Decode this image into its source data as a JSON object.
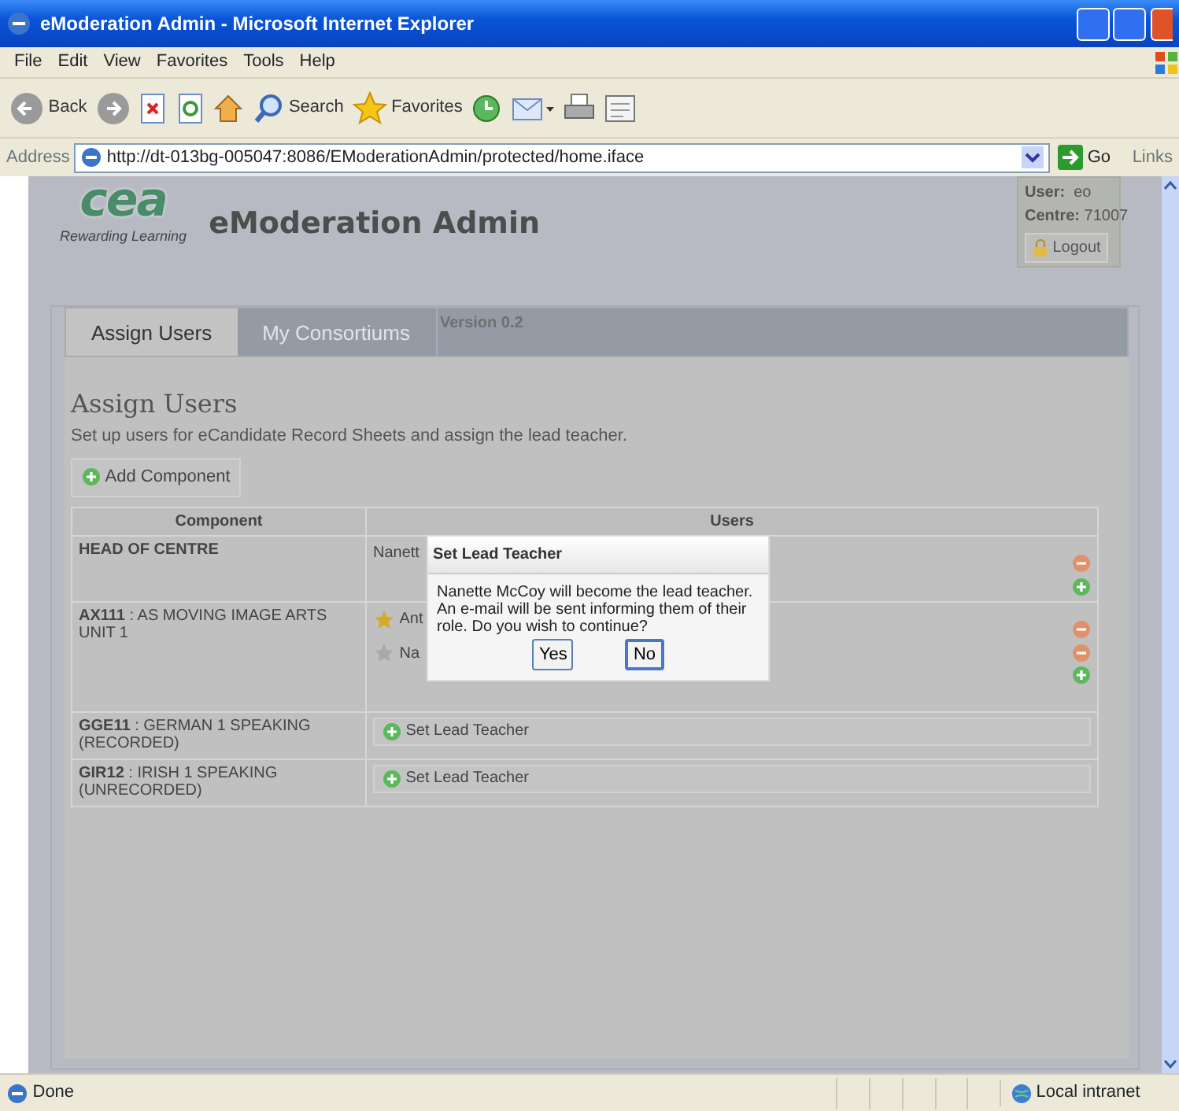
{
  "window": {
    "title": "eModeration Admin - Microsoft Internet Explorer"
  },
  "menu": [
    "File",
    "Edit",
    "View",
    "Favorites",
    "Tools",
    "Help"
  ],
  "toolbar": {
    "back": "Back",
    "search": "Search",
    "favorites": "Favorites"
  },
  "address": {
    "label": "Address",
    "url": "http://dt-013bg-005047:8086/EModerationAdmin/protected/home.iface",
    "go": "Go",
    "links": "Links"
  },
  "header": {
    "logo": "cea",
    "tagline": "Rewarding Learning",
    "title": "eModeration Admin"
  },
  "user_box": {
    "user_label": "User:",
    "user": "eo",
    "centre_label": "Centre:",
    "centre": "71007",
    "logout": "Logout"
  },
  "tabs": [
    {
      "label": "Assign Users",
      "selected": true
    },
    {
      "label": "My Consortiums",
      "selected": false
    }
  ],
  "version": "Version 0.2",
  "section": {
    "title": "Assign Users",
    "description": "Set up users for eCandidate Record Sheets and assign the lead teacher.",
    "add_button": "Add Component"
  },
  "table": {
    "columns": [
      "Component",
      "Users"
    ],
    "rows": [
      {
        "kind": "head",
        "component": "HEAD OF CENTRE",
        "users": [
          {
            "name": "Nanett"
          }
        ]
      },
      {
        "kind": "component",
        "component": "**AX111** : AS MOVING IMAGE ARTS UNIT 1",
        "users": [
          {
            "name": "Ant",
            "lead": true
          },
          {
            "name": "Na",
            "lead": false
          }
        ]
      },
      {
        "kind": "component",
        "component": "**GGE11** : GERMAN 1 SPEAKING (RECORDED)",
        "button": "Set Lead Teacher"
      },
      {
        "kind": "component",
        "component": "**GIR12** : IRISH 1 SPEAKING (UNRECORDED)",
        "button": "Set Lead Teacher"
      }
    ]
  },
  "dialog": {
    "title": "Set Lead Teacher",
    "message": "Nanette McCoy will become the lead teacher. An e-mail will be sent informing them of their role. Do you wish to continue?",
    "buttons": [
      {
        "label": "Yes",
        "focused": false
      },
      {
        "label": "No",
        "focused": true
      }
    ]
  },
  "status_bar": {
    "text": "Done",
    "zone": "Local intranet"
  }
}
